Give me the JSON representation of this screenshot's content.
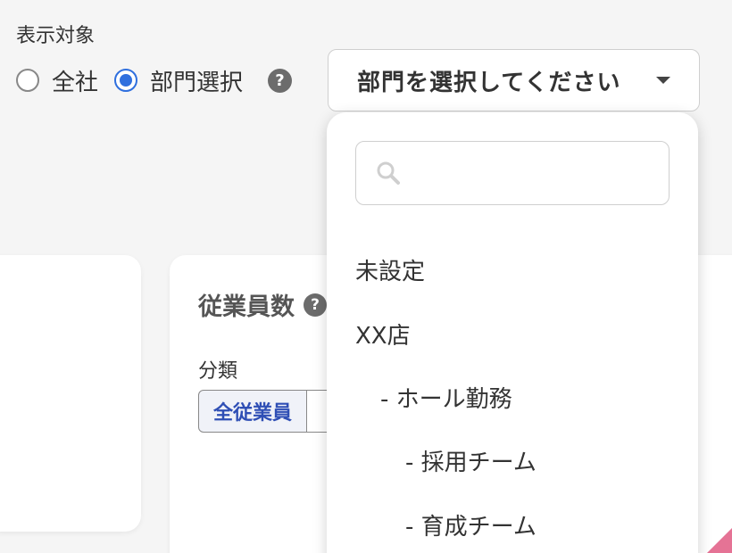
{
  "filter": {
    "label": "表示対象",
    "radio_all": "全社",
    "radio_dept": "部門選択",
    "selected": "部門選択",
    "help": "?"
  },
  "select": {
    "placeholder": "部門を選択してください"
  },
  "card": {
    "title": "従業員数",
    "help": "?",
    "category_label": "分類",
    "segment_all": "全従業員"
  },
  "dropdown": {
    "search_placeholder": "",
    "options": [
      "未設定",
      "XX店",
      "- ホール勤務",
      "- 採用チーム",
      "- 育成チーム"
    ]
  },
  "colors": {
    "accent": "#2f6fde",
    "segment_text": "#2f4fb5",
    "pink": "#e57395"
  }
}
